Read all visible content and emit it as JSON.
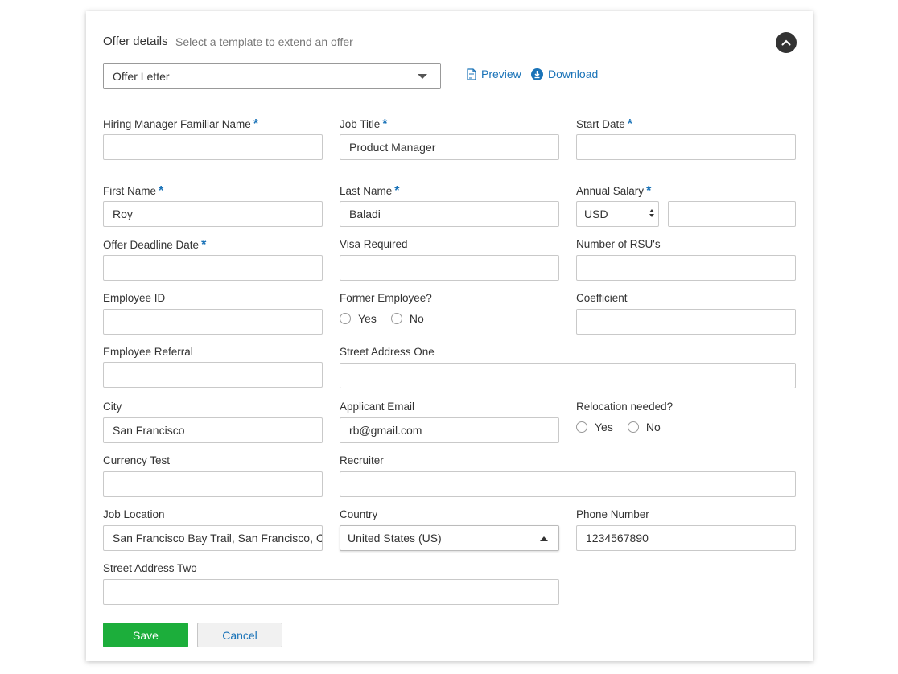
{
  "header": {
    "title": "Offer details",
    "subtitle": "Select a template to extend an offer"
  },
  "template": {
    "selected": "Offer Letter",
    "preview_label": "Preview",
    "download_label": "Download"
  },
  "fields": {
    "hiring_manager": {
      "label": "Hiring Manager Familiar Name",
      "required": "*",
      "value": ""
    },
    "job_title": {
      "label": "Job Title",
      "required": "*",
      "value": "Product Manager"
    },
    "start_date": {
      "label": "Start Date",
      "required": "*",
      "value": ""
    },
    "first_name": {
      "label": "First Name",
      "required": "*",
      "value": "Roy"
    },
    "last_name": {
      "label": "Last Name",
      "required": "*",
      "value": "Baladi"
    },
    "annual_salary": {
      "label": "Annual Salary",
      "required": "*",
      "currency": "USD",
      "value": ""
    },
    "offer_deadline": {
      "label": "Offer Deadline Date",
      "required": "*",
      "value": ""
    },
    "visa_required": {
      "label": "Visa Required",
      "value": ""
    },
    "rsus": {
      "label": "Number of RSU's",
      "value": ""
    },
    "employee_id": {
      "label": "Employee ID",
      "value": ""
    },
    "former_employee": {
      "label": "Former Employee?",
      "yes": "Yes",
      "no": "No"
    },
    "coefficient": {
      "label": "Coefficient",
      "value": ""
    },
    "employee_referral": {
      "label": "Employee Referral",
      "value": ""
    },
    "street_one": {
      "label": "Street Address One",
      "value": ""
    },
    "city": {
      "label": "City",
      "value": "San Francisco"
    },
    "applicant_email": {
      "label": "Applicant Email",
      "value": "rb@gmail.com"
    },
    "relocation": {
      "label": "Relocation needed?",
      "yes": "Yes",
      "no": "No"
    },
    "currency_test": {
      "label": "Currency Test",
      "value": ""
    },
    "recruiter": {
      "label": "Recruiter",
      "value": ""
    },
    "job_location": {
      "label": "Job Location",
      "value": "San Francisco Bay Trail, San Francisco, CA,"
    },
    "country": {
      "label": "Country",
      "value": "United States (US)"
    },
    "phone": {
      "label": "Phone Number",
      "value": "1234567890"
    },
    "street_two": {
      "label": "Street Address Two",
      "value": ""
    }
  },
  "actions": {
    "save_label": "Save",
    "cancel_label": "Cancel"
  },
  "colors": {
    "accent": "#1a73b8",
    "save_green": "#1cae3b"
  }
}
